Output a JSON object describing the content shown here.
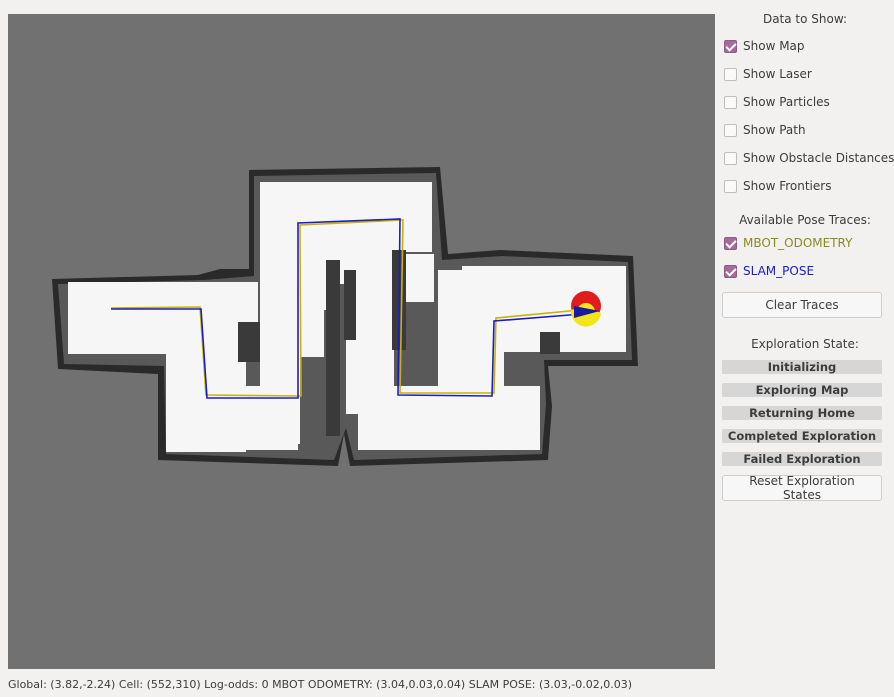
{
  "panel": {
    "data_to_show_title": "Data to Show:",
    "checkboxes": [
      {
        "label": "Show Map",
        "checked": true
      },
      {
        "label": "Show Laser",
        "checked": false
      },
      {
        "label": "Show Particles",
        "checked": false
      },
      {
        "label": "Show Path",
        "checked": false
      },
      {
        "label": "Show Obstacle Distances",
        "checked": false
      },
      {
        "label": "Show Frontiers",
        "checked": false
      }
    ],
    "pose_traces_title": "Available Pose Traces:",
    "pose_traces": [
      {
        "label": "MBOT_ODOMETRY",
        "checked": true,
        "color": "#8a8a1a"
      },
      {
        "label": "SLAM_POSE",
        "checked": true,
        "color": "#1a1ad0"
      }
    ],
    "clear_traces_label": "Clear Traces",
    "exploration_title": "Exploration State:",
    "exploration_states": [
      "Initializing",
      "Exploring Map",
      "Returning Home",
      "Completed Exploration",
      "Failed Exploration"
    ],
    "reset_label": "Reset Exploration States"
  },
  "status": {
    "text": "Global: (3.82,-2.24) Cell: (552,310) Log-odds: 0   MBOT  ODOMETRY: (3.04,0.03,0.04)  SLAM  POSE: (3.03,-0.02,0.03)"
  },
  "map": {
    "background_color": "#717171",
    "free_color": "#f6f6f6",
    "wall_color": "#1e1e1e",
    "odometry_trace_color": "#c8b400",
    "slam_trace_color": "#1c1cc8",
    "robot_colors": {
      "outer": "#e21b1b",
      "inner": "#f3e51a",
      "heading": "#1a1aa0"
    }
  }
}
